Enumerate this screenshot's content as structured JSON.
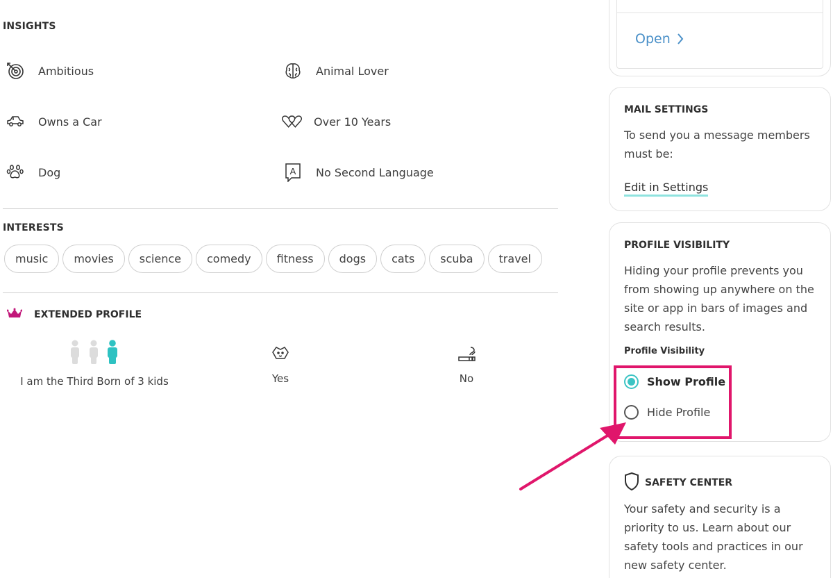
{
  "insights": {
    "title": "INSIGHTS",
    "items": [
      {
        "label": "Ambitious",
        "icon": "target-icon"
      },
      {
        "label": "Animal Lover",
        "icon": "brain-icon"
      },
      {
        "label": "Owns a Car",
        "icon": "car-icon"
      },
      {
        "label": "Over 10 Years",
        "icon": "hearts-icon"
      },
      {
        "label": "Dog",
        "icon": "paw-icon"
      },
      {
        "label": "No Second Language",
        "icon": "language-icon"
      }
    ]
  },
  "interests": {
    "title": "INTERESTS",
    "chips": [
      "music",
      "movies",
      "science",
      "comedy",
      "fitness",
      "dogs",
      "cats",
      "scuba",
      "travel"
    ]
  },
  "extended_profile": {
    "title": "EXTENDED PROFILE",
    "items": [
      {
        "label": "I am the Third Born of 3 kids",
        "icon": "siblings-icon"
      },
      {
        "label": "Yes",
        "icon": "pet-icon"
      },
      {
        "label": "No",
        "icon": "smoking-icon"
      }
    ]
  },
  "top_card": {
    "open_label": "Open"
  },
  "mail_settings": {
    "title": "MAIL SETTINGS",
    "text": "To send you a message members must be:",
    "edit_label": "Edit in Settings"
  },
  "profile_visibility": {
    "title": "PROFILE VISIBILITY",
    "text": "Hiding your profile prevents you from showing up anywhere on the site or app in bars of images and search results.",
    "subtitle": "Profile Visibility",
    "options": [
      {
        "label": "Show Profile",
        "selected": true
      },
      {
        "label": "Hide Profile",
        "selected": false
      }
    ]
  },
  "safety_center": {
    "title": "SAFETY CENTER",
    "text": "Your safety and security is a priority to us. Learn about our safety tools and practices in our new safety center."
  },
  "colors": {
    "accent_teal": "#3cc4c4",
    "highlight_pink": "#e0166b",
    "link_blue": "#4a90c8",
    "crown_pink": "#c2187a"
  }
}
